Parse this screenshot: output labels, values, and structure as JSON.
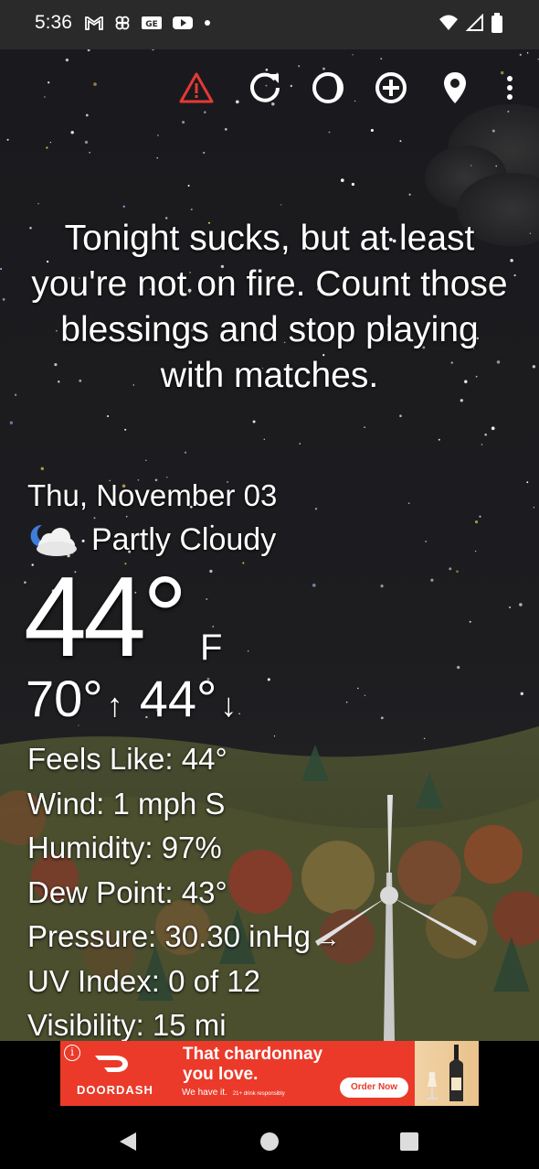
{
  "status_bar": {
    "time": "5:36",
    "left_icons": [
      "gmail-icon",
      "pinwheel-icon",
      "ge-icon",
      "youtube-icon",
      "dot-icon"
    ],
    "right_icons": [
      "wifi-icon",
      "signal-icon",
      "battery-icon"
    ]
  },
  "toolbar": {
    "icons": [
      "alert-icon",
      "refresh-icon",
      "moon-phase-icon",
      "add-location-icon",
      "location-pin-icon",
      "more-vert-icon"
    ],
    "alert_color": "#e53935"
  },
  "quote": "Tonight sucks, but at least you're not on fire. Count those blessings and stop playing with matches.",
  "weather": {
    "date": "Thu, November 03",
    "condition": "Partly Cloudy",
    "condition_icon": "partly-cloudy-night-icon",
    "temperature": "44°",
    "unit": "F",
    "high": "70°",
    "low": "44°",
    "high_arrow": "↑",
    "low_arrow": "↓"
  },
  "details": {
    "feels_like": "Feels Like:  44°",
    "wind": "Wind:  1 mph S",
    "humidity": "Humidity:  97%",
    "dew_point": "Dew Point:  43°",
    "pressure": "Pressure:  30.30 inHg",
    "pressure_trend": "→",
    "uv_index": "UV Index:  0 of 12",
    "visibility": "Visibility:  15 mi"
  },
  "ad": {
    "brand": "DOORDASH",
    "headline": "That chardonnay you love.",
    "subtext": "We have it.",
    "disclaimer": "21+ drink responsibly",
    "cta": "Order Now",
    "info": "i",
    "brand_color": "#eb3a2a"
  },
  "nav_bar": {
    "icons": [
      "back-icon",
      "home-icon",
      "recents-icon"
    ]
  }
}
